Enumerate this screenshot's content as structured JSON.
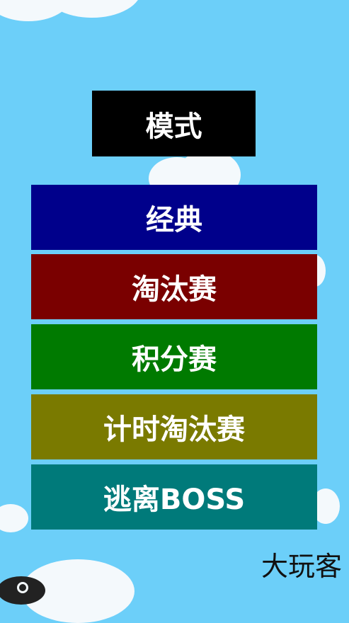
{
  "title": "模式",
  "modes": [
    {
      "label": "经典",
      "color": "#00008b"
    },
    {
      "label": "淘汰赛",
      "color": "#7a0000"
    },
    {
      "label": "积分赛",
      "color": "#007a00"
    },
    {
      "label": "计时淘汰赛",
      "color": "#7a7a00"
    },
    {
      "label": "逃离BOSS",
      "color": "#007a7a"
    }
  ],
  "watermark": "大玩客",
  "colors": {
    "sky": "#6ccff9",
    "cloud": "#f4f9fc"
  },
  "icons": {
    "corner": "circle-icon"
  }
}
